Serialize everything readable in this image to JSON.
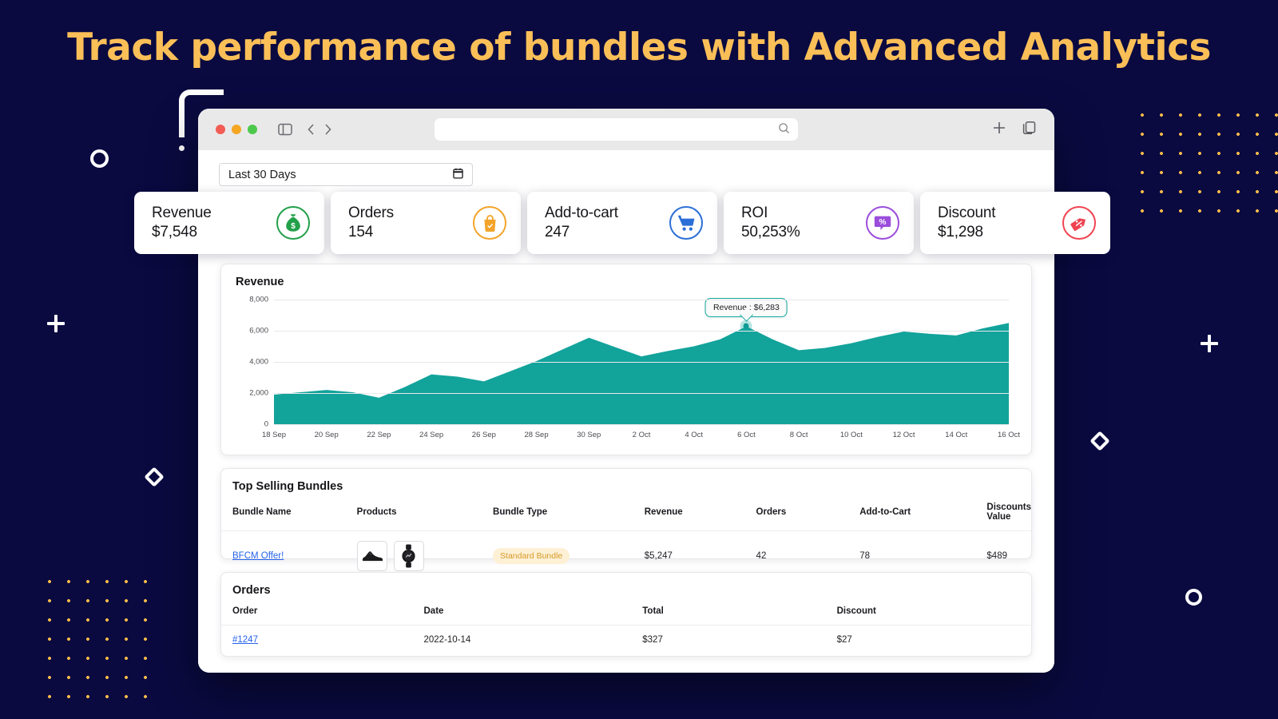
{
  "hero": {
    "title": "Track performance of bundles with Advanced Analytics"
  },
  "colors": {
    "background": "#0a0a41",
    "title": "#fbbf58",
    "accent_teal": "#12a39b",
    "dots": "#f9b949",
    "link": "#2563eb"
  },
  "browser": {
    "traffic_lights": [
      "close",
      "minimize",
      "maximize"
    ],
    "sidebar_icon": "sidebar-icon",
    "back_icon": "chevron-left-icon",
    "forward_icon": "chevron-right-icon",
    "url_value": "",
    "url_placeholder": "",
    "search_icon": "search-icon",
    "new_tab_icon": "plus-icon",
    "tabs_icon": "copy-tabs-icon"
  },
  "filter": {
    "date_range": "Last 30 Days",
    "calendar_icon": "calendar-icon"
  },
  "metrics": [
    {
      "label": "Revenue",
      "value": "$7,548",
      "icon": "money-bag-icon",
      "color": "#22a04a"
    },
    {
      "label": "Orders",
      "value": "154",
      "icon": "shopping-bag-icon",
      "color": "#f2a42a"
    },
    {
      "label": "Add-to-cart",
      "value": "247",
      "icon": "shopping-cart-icon",
      "color": "#2b6fd6"
    },
    {
      "label": "ROI",
      "value": "50,253%",
      "icon": "percent-bubble-icon",
      "color": "#9b4ddb"
    },
    {
      "label": "Discount",
      "value": "$1,298",
      "icon": "discount-tag-icon",
      "color": "#ef4452"
    }
  ],
  "chart_panel": {
    "title": "Revenue"
  },
  "chart_data": {
    "type": "area",
    "title": "Revenue",
    "xlabel": "",
    "ylabel": "",
    "ylim": [
      0,
      8000
    ],
    "yticks": [
      0,
      2000,
      4000,
      6000,
      8000
    ],
    "ytick_labels": [
      "0",
      "2,000",
      "4,000",
      "6,000",
      "8,000"
    ],
    "grid": true,
    "legend": "none",
    "series_name": "Revenue",
    "x": [
      "18 Sep",
      "19 Sep",
      "20 Sep",
      "21 Sep",
      "22 Sep",
      "23 Sep",
      "24 Sep",
      "25 Sep",
      "26 Sep",
      "27 Sep",
      "28 Sep",
      "29 Sep",
      "30 Sep",
      "1 Oct",
      "2 Oct",
      "3 Oct",
      "4 Oct",
      "5 Oct",
      "6 Oct",
      "7 Oct",
      "8 Oct",
      "9 Oct",
      "10 Oct",
      "11 Oct",
      "12 Oct",
      "13 Oct",
      "14 Oct",
      "15 Oct",
      "16 Oct"
    ],
    "values": [
      1900,
      2050,
      2200,
      2050,
      1700,
      2400,
      3200,
      3050,
      2750,
      3400,
      4050,
      4800,
      5550,
      4950,
      4350,
      4700,
      5000,
      5450,
      6283,
      5450,
      4750,
      4900,
      5200,
      5600,
      5950,
      5800,
      5700,
      6150,
      6500
    ],
    "xtick_labels": [
      "18 Sep",
      "20 Sep",
      "22 Sep",
      "24 Sep",
      "26 Sep",
      "28 Sep",
      "30 Sep",
      "2  Oct",
      "4 Oct",
      "6 Oct",
      "8 Oct",
      "10  Oct",
      "12  Oct",
      "14  Oct",
      "16  Oct"
    ],
    "xtick_indices": [
      0,
      2,
      4,
      6,
      8,
      10,
      12,
      14,
      16,
      18,
      20,
      22,
      24,
      26,
      28
    ],
    "highlight": {
      "x": "6 Oct",
      "index": 18,
      "value": 6283,
      "tooltip": "Revenue : $6,283"
    }
  },
  "bundles": {
    "title": "Top Selling Bundles",
    "columns": [
      "Bundle Name",
      "Products",
      "Bundle Type",
      "Revenue",
      "Orders",
      "Add-to-Cart",
      "Discounts Value"
    ],
    "rows": [
      {
        "name": "BFCM Offer!",
        "products": [
          "sneaker-thumbnail",
          "smartwatch-thumbnail"
        ],
        "type": "Standard Bundle",
        "revenue": "$5,247",
        "orders": "42",
        "add_to_cart": "78",
        "discounts_value": "$489"
      }
    ]
  },
  "orders": {
    "title": "Orders",
    "columns": [
      "Order",
      "Date",
      "Total",
      "Discount"
    ],
    "rows": [
      {
        "order": "#1247",
        "date": "2022-10-14",
        "total": "$327",
        "discount": "$27"
      }
    ]
  }
}
